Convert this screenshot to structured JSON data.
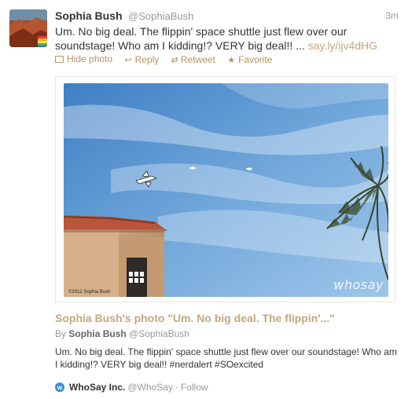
{
  "tweet": {
    "display_name": "Sophia Bush",
    "handle": "@SophiaBush",
    "timestamp": "3m",
    "text": "Um. No big deal. The flippin' space shuttle just flew over our soundstage! Who am I kidding!? VERY big deal!! ...",
    "link": "say.ly/ijv4dHG"
  },
  "actions": {
    "hide_photo": "Hide photo",
    "reply": "Reply",
    "retweet": "Retweet",
    "favorite": "Favorite"
  },
  "photo": {
    "watermark": "whosay",
    "copyright": "©2012 Sophia Bush"
  },
  "card": {
    "title": "Sophia Bush's photo \"Um. No big deal. The flippin'...\"",
    "by_label": "By",
    "author_name": "Sophia Bush",
    "author_handle": "@SophiaBush",
    "description": "Um. No big deal. The flippin' space shuttle just flew over our soundstage! Who am I kidding!? VERY big deal!! #nerdalert #SOexcited",
    "site_name": "WhoSay Inc.",
    "site_handle": "@WhoSay",
    "separator": "·",
    "follow": "Follow"
  },
  "icons": {
    "photo": "photo-icon",
    "reply": "reply-arrow-icon",
    "retweet": "retweet-icon",
    "favorite": "star-icon",
    "site": "whosay-icon"
  },
  "colors": {
    "link": "#c4a77d",
    "action": "#b59560",
    "muted": "#999999",
    "text": "#333333"
  }
}
